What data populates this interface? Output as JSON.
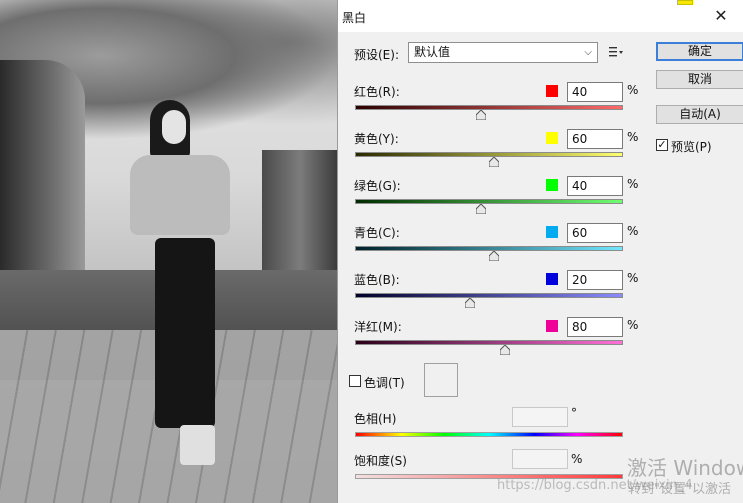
{
  "dialog": {
    "title": "黑白",
    "close_glyph": "✕",
    "preset_label": "预设(E):",
    "preset_value": "默认值",
    "buttons": {
      "ok": "确定",
      "cancel": "取消",
      "auto": "自动(A)"
    },
    "preview": {
      "label": "预览(P)",
      "checked": true
    }
  },
  "sliders": [
    {
      "label": "红色(R):",
      "value": "40",
      "unit": "%",
      "swatch": "#ff0000",
      "grad_from": "#2a0000",
      "grad_to": "#ff6a6a",
      "fraction": 0.47
    },
    {
      "label": "黄色(Y):",
      "value": "60",
      "unit": "%",
      "swatch": "#ffff00",
      "grad_from": "#2a2a00",
      "grad_to": "#ffff70",
      "fraction": 0.52
    },
    {
      "label": "绿色(G):",
      "value": "40",
      "unit": "%",
      "swatch": "#00ff00",
      "grad_from": "#002a00",
      "grad_to": "#70ff70",
      "fraction": 0.47
    },
    {
      "label": "青色(C):",
      "value": "60",
      "unit": "%",
      "swatch": "#00aaee",
      "grad_from": "#00202a",
      "grad_to": "#70e8ff",
      "fraction": 0.52
    },
    {
      "label": "蓝色(B):",
      "value": "20",
      "unit": "%",
      "swatch": "#0000dd",
      "grad_from": "#00002a",
      "grad_to": "#8a8aff",
      "fraction": 0.43
    },
    {
      "label": "洋红(M):",
      "value": "80",
      "unit": "%",
      "swatch": "#ee0099",
      "grad_from": "#2a0018",
      "grad_to": "#ff70d8",
      "fraction": 0.56
    }
  ],
  "tint": {
    "label": "色调(T)",
    "checked": false,
    "hue_label": "色相(H)",
    "hue_unit": "°",
    "saturation_label": "饱和度(S)",
    "saturation_unit": "%"
  },
  "watermarks": {
    "windows_title": "激活 Window",
    "windows_sub": "转到\"设置\"以激活",
    "csdn": "https://blog.csdn.net/weixin_4"
  },
  "icons": {
    "menu": "list-options-icon",
    "close": "close-icon",
    "dropdown": "chevron-down-icon",
    "check": "checkmark-icon"
  }
}
